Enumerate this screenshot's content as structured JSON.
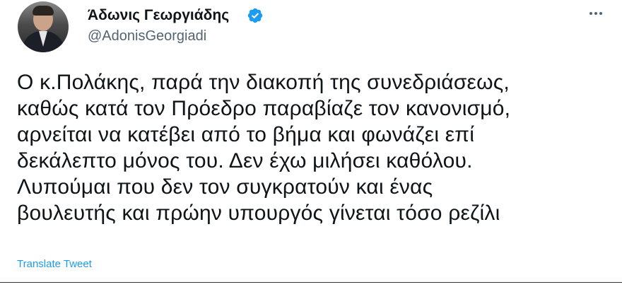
{
  "tweet": {
    "author": {
      "display_name": "Άδωνις Γεωργιάδης",
      "username": "@AdonisGeorgiadi",
      "verified": true,
      "avatar_icon": "avatar-photo"
    },
    "more_icon": "more-dots-icon",
    "text": "Ο κ.Πολάκης, παρά την διακοπή της συνεδριάσεως,\nκαθώς κατά τον Πρόεδρο παραβίαζε τον κανονισμό,\nαρνείται να κατέβει από το βήμα και φωνάζει επί\nδεκάλεπτο μόνος του. Δεν έχω μιλήσει καθόλου.\nΛυπούμαι που δεν τον συγκρατούν και ένας\nβουλευτής και πρώην υπουργός γίνεται τόσο ρεζίλι",
    "translate_label": "Translate Tweet"
  },
  "colors": {
    "text_primary": "#0f1419",
    "text_secondary": "#536471",
    "accent": "#1d9bf0"
  }
}
